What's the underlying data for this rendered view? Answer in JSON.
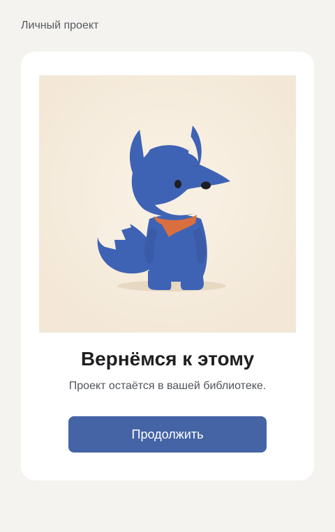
{
  "header": {
    "context_label": "Личный проект"
  },
  "dialog": {
    "title": "Вернёмся к этому",
    "message": "Проект остаётся в вашей библиотеке.",
    "continue_label": "Продолжить"
  },
  "illustration": {
    "subject": "fox-mascot-icon"
  },
  "colors": {
    "page_background": "#f4f3f0",
    "card_background": "#ffffff",
    "illustration_background": "#f6ecdd",
    "fox_fur": "#3f63b4",
    "fox_cream": "#f7efe2",
    "scarf": "#d96f3f",
    "button": "#4564a5",
    "title_text": "#1f1f22",
    "body_text": "#4f535a"
  }
}
